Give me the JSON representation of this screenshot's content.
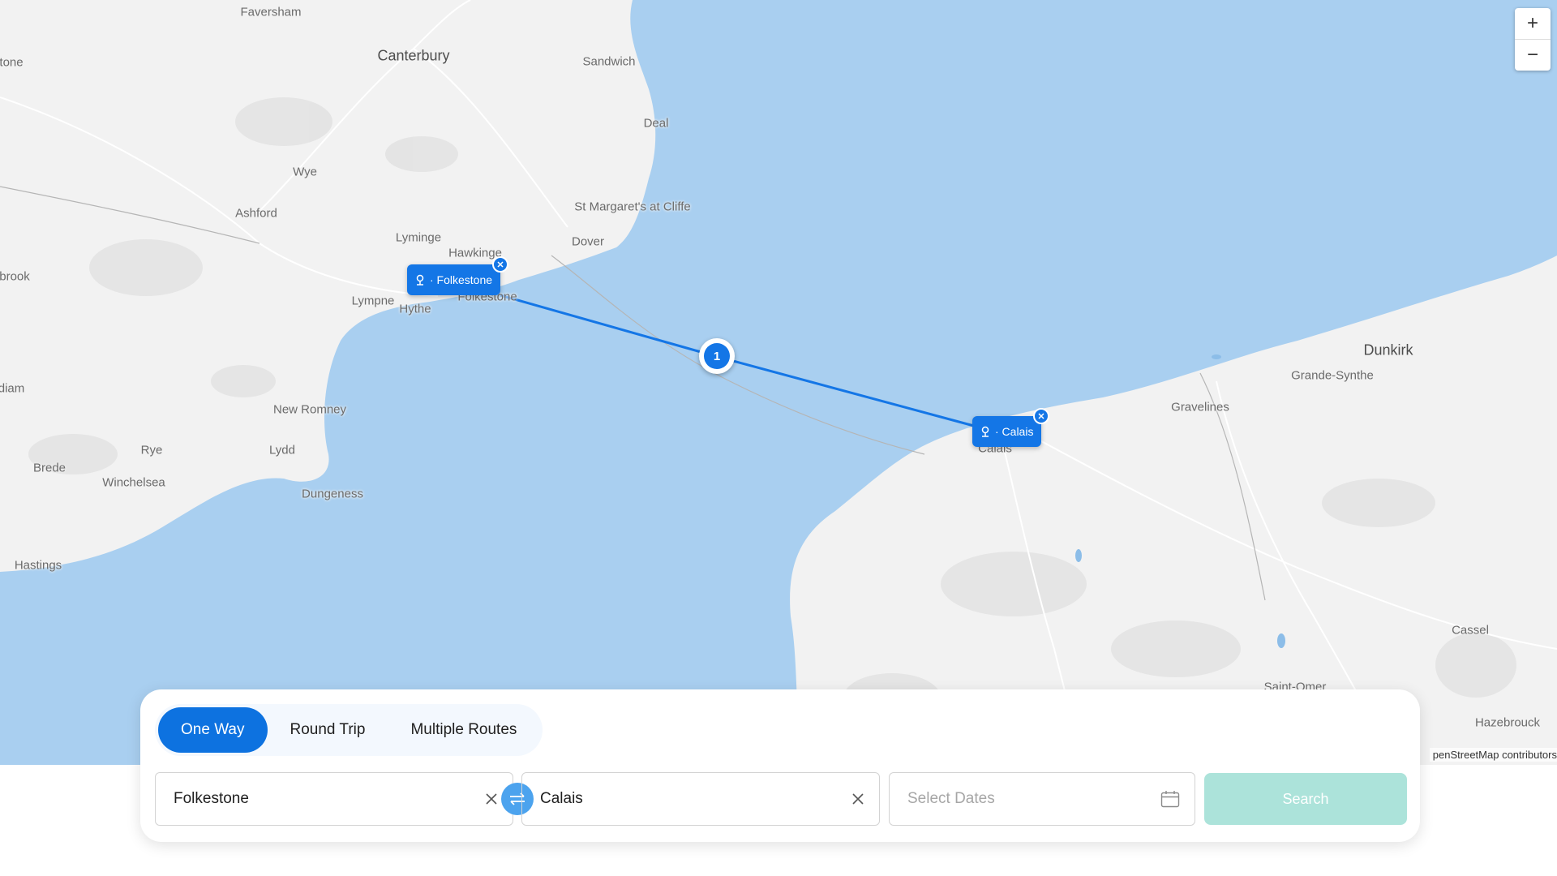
{
  "map": {
    "places": [
      {
        "name": "Faversham"
      },
      {
        "name": "Canterbury"
      },
      {
        "name": "Sandwich"
      },
      {
        "name": "Deal"
      },
      {
        "name": "Wye"
      },
      {
        "name": "Ashford"
      },
      {
        "name": "St Margaret's at Cliffe"
      },
      {
        "name": "Lyminge"
      },
      {
        "name": "Dover"
      },
      {
        "name": "Hawkinge"
      },
      {
        "name": "Lympne"
      },
      {
        "name": "Hythe"
      },
      {
        "name": "Folkestone"
      },
      {
        "name": "New Romney"
      },
      {
        "name": "Rye"
      },
      {
        "name": "Lydd"
      },
      {
        "name": "Brede"
      },
      {
        "name": "Winchelsea"
      },
      {
        "name": "Dungeness"
      },
      {
        "name": "Hastings"
      },
      {
        "name": "Dunkirk"
      },
      {
        "name": "Grande-Synthe"
      },
      {
        "name": "Gravelines"
      },
      {
        "name": "Calais"
      },
      {
        "name": "Cassel"
      },
      {
        "name": "Saint-Omer"
      },
      {
        "name": "Hazebrouck"
      },
      {
        "name": "tone"
      },
      {
        "name": "brook"
      },
      {
        "name": "diam"
      }
    ],
    "route": {
      "origin_label": "· Folkestone",
      "destination_label": "· Calais",
      "stop_number": "1",
      "line_color": "#1476e6"
    },
    "zoom_in": "+",
    "zoom_out": "−",
    "attribution": "penStreetMap contributors",
    "colors": {
      "sea": "#a9cff0",
      "land": "#f2f2f2",
      "marker": "#1476e6"
    }
  },
  "search": {
    "tabs": [
      {
        "label": "One Way",
        "active": true
      },
      {
        "label": "Round Trip",
        "active": false
      },
      {
        "label": "Multiple Routes",
        "active": false
      }
    ],
    "from_value": "Folkestone",
    "to_value": "Calais",
    "dates_placeholder": "Select Dates",
    "search_label": "Search",
    "colors": {
      "active_tab": "#0d72e0",
      "search_button": "#ace3da",
      "swap_button": "#4ca3ee"
    }
  },
  "icons": {
    "clear": "close-icon",
    "swap": "swap-arrows-icon",
    "calendar": "calendar-icon",
    "marker_pin": "port-pin-icon"
  }
}
